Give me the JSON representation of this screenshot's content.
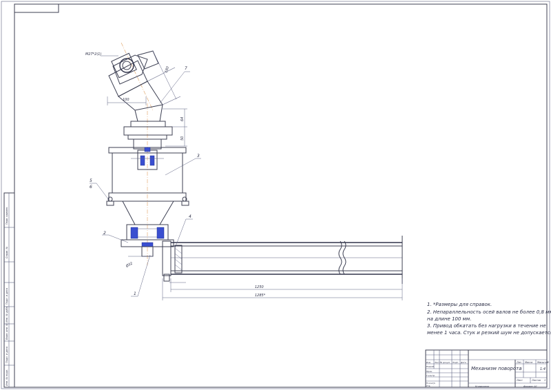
{
  "drawing": {
    "dims": {
      "flange_size": "М27*2(1)",
      "d100": "100",
      "d64": "64",
      "d50": "50",
      "d180": "180",
      "d1250": "1250",
      "d1285": "1285*",
      "d32": "Ø32"
    },
    "labels": {
      "p1": "1",
      "p2": "2",
      "p3": "3",
      "p4": "4",
      "p5": "5",
      "p6": "6",
      "p7": "7"
    },
    "notes": [
      "1. *Размеры для справок.",
      "2. Непараллельность осей валов не более 0,8 мм",
      "на длине 100 мм.",
      "3. Привод обкатать без нагрузки в течение не",
      "менее 1 часа. Стук и резкий шум не допускается."
    ],
    "title_block": {
      "name": "Механизм поворота",
      "lit": "Лит.",
      "mass": "Масса",
      "scale": "Масштаб",
      "scale_value": "1:4",
      "sheet": "Лист",
      "sheets": "Листов",
      "sheets_value": "1",
      "copied": "Копировал",
      "format": "Формат A1",
      "cols": [
        "Изм",
        "Лист",
        "№ докум.",
        "Подп.",
        "Дата"
      ],
      "rows": [
        "Разраб.",
        "Пров.",
        "Т.контр.",
        "",
        "Н.контр.",
        "Утв."
      ]
    },
    "side_strip": [
      "Перв. примен.",
      "Справ. №",
      "Подп. и дата",
      "Инв. № дубл.",
      "Взам. инв. №",
      "Подп. и дата",
      "Инв. № подл."
    ]
  }
}
